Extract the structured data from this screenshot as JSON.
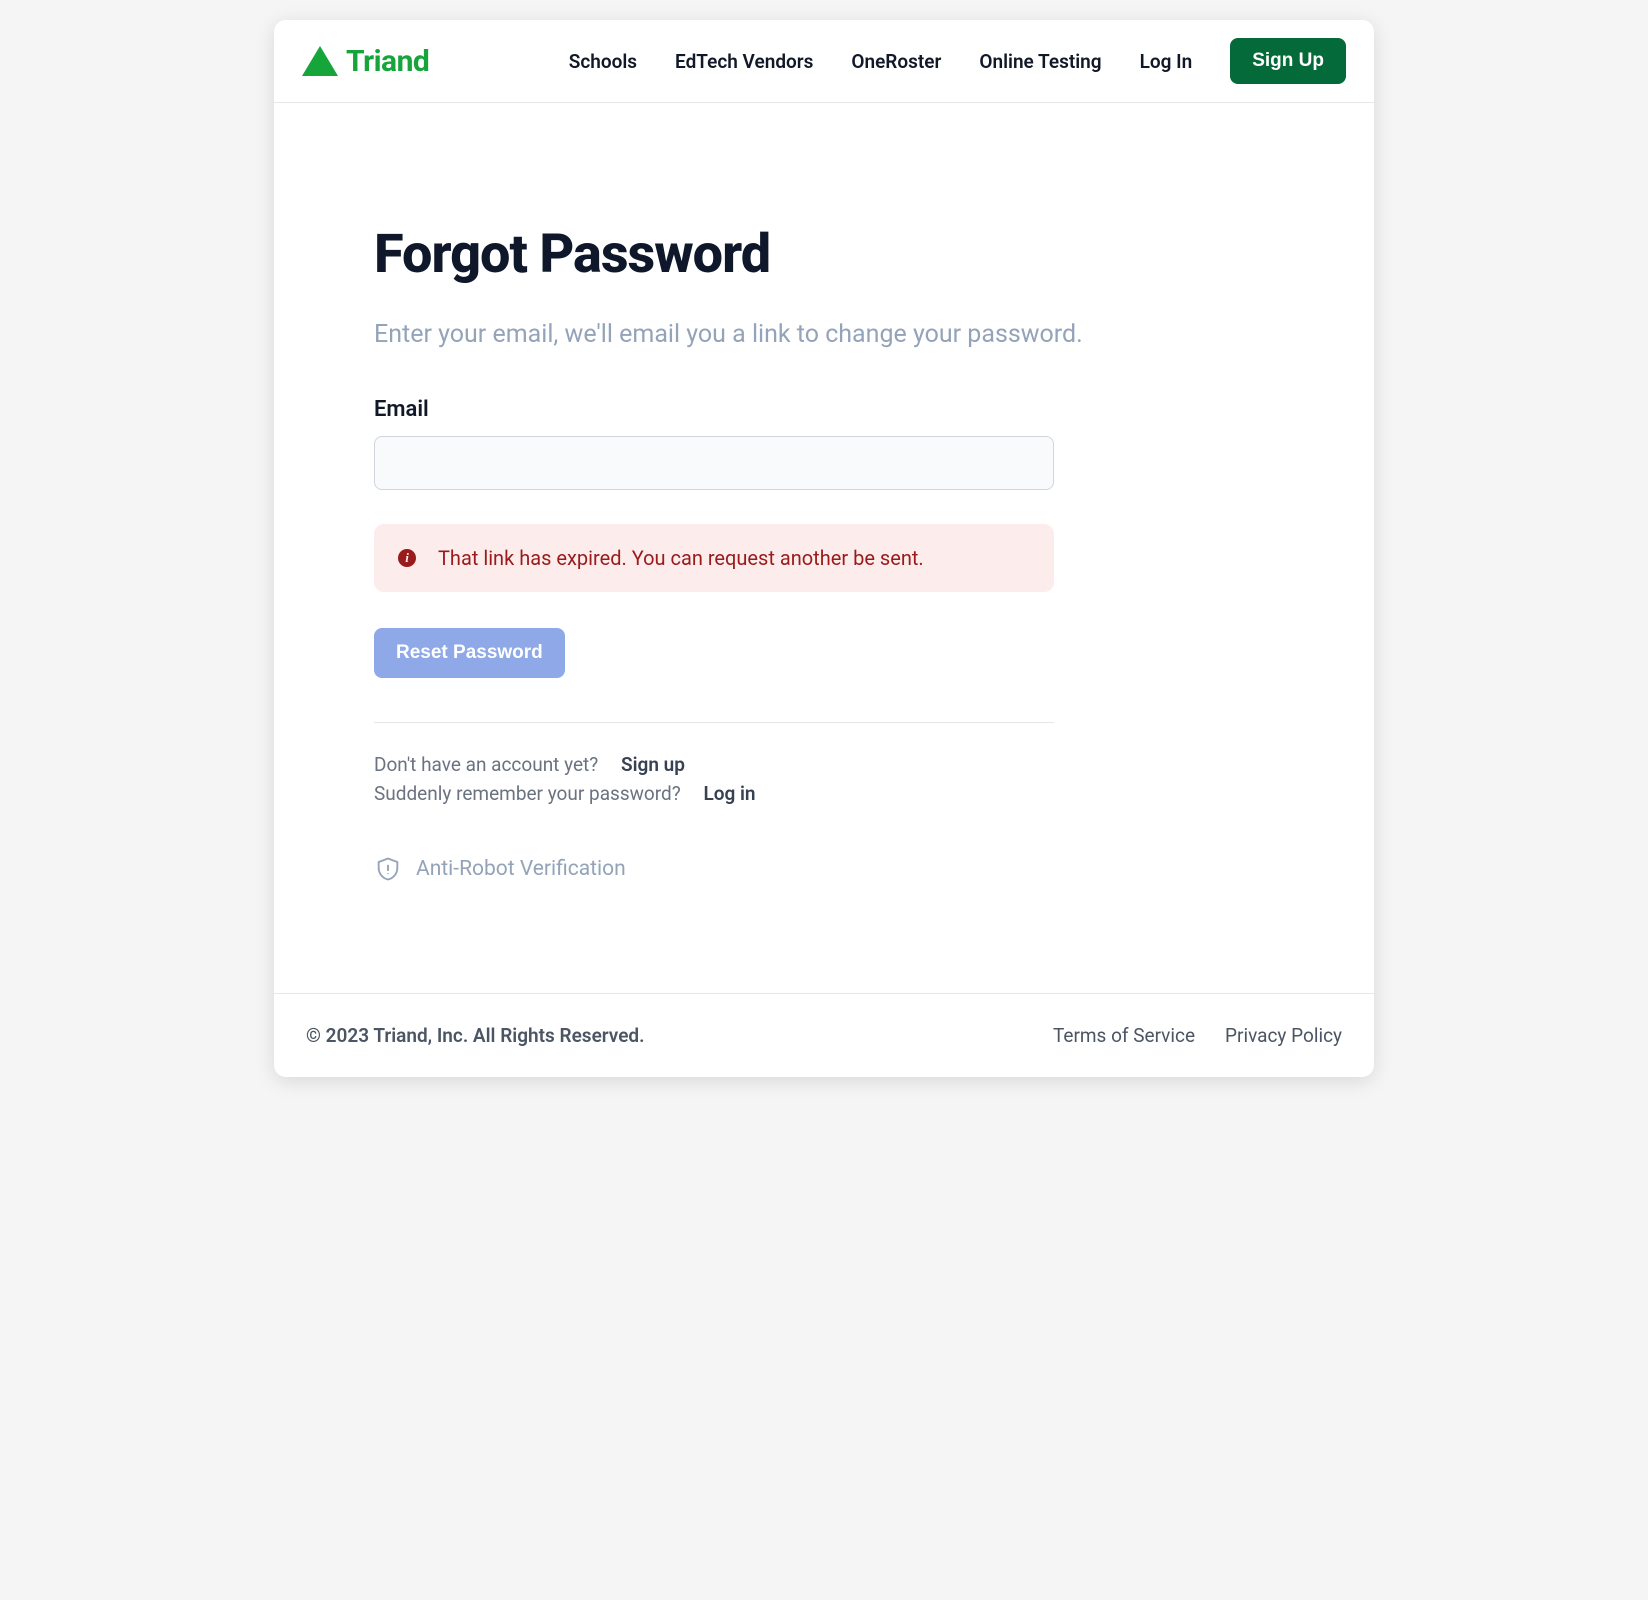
{
  "brand": {
    "name": "Triand"
  },
  "nav": {
    "items": [
      {
        "label": "Schools"
      },
      {
        "label": "EdTech Vendors"
      },
      {
        "label": "OneRoster"
      },
      {
        "label": "Online Testing"
      },
      {
        "label": "Log In"
      }
    ],
    "signup_label": "Sign Up"
  },
  "page": {
    "title": "Forgot Password",
    "subtitle": "Enter your email, we'll email you a link to change your password.",
    "email_label": "Email",
    "email_value": "",
    "alert_message": "That link has expired. You can request another be sent.",
    "reset_button": "Reset Password",
    "signup_prompt": "Don't have an account yet?",
    "signup_link": "Sign up",
    "login_prompt": "Suddenly remember your password?",
    "login_link": "Log in",
    "verify_label": "Anti-Robot Verification"
  },
  "footer": {
    "copyright": "© 2023  Triand, Inc. All Rights Reserved.",
    "links": [
      {
        "label": "Terms of Service"
      },
      {
        "label": "Privacy Policy"
      }
    ]
  },
  "colors": {
    "brand_green": "#15a53a",
    "signup_green": "#046a3a",
    "error_bg": "#fdecec",
    "error_text": "#991b1b",
    "reset_blue": "#8ea8e8"
  }
}
